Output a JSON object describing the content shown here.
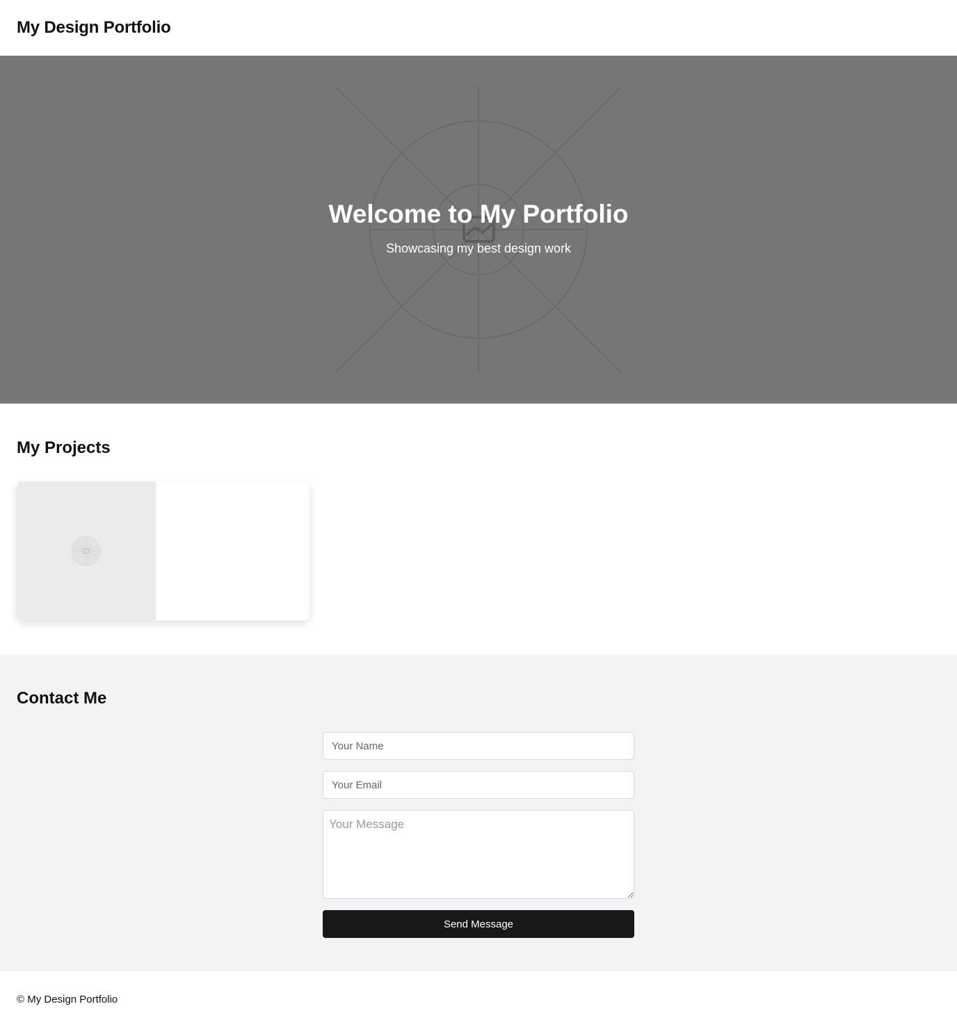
{
  "header": {
    "title": "My Design Portfolio"
  },
  "hero": {
    "title": "Welcome to My Portfolio",
    "subtitle": "Showcasing my best design work",
    "background_color": "#767676",
    "image_icon": "image-placeholder-icon"
  },
  "projects": {
    "title": "My Projects",
    "items": [
      {
        "thumbnail_icon": "image-placeholder-icon"
      }
    ]
  },
  "contact": {
    "title": "Contact Me",
    "name_placeholder": "Your Name",
    "email_placeholder": "Your Email",
    "message_placeholder": "Your Message",
    "submit_label": "Send Message",
    "background_color": "#f2f3f5",
    "button_color": "#18181b"
  },
  "footer": {
    "text": "© My Design Portfolio"
  }
}
